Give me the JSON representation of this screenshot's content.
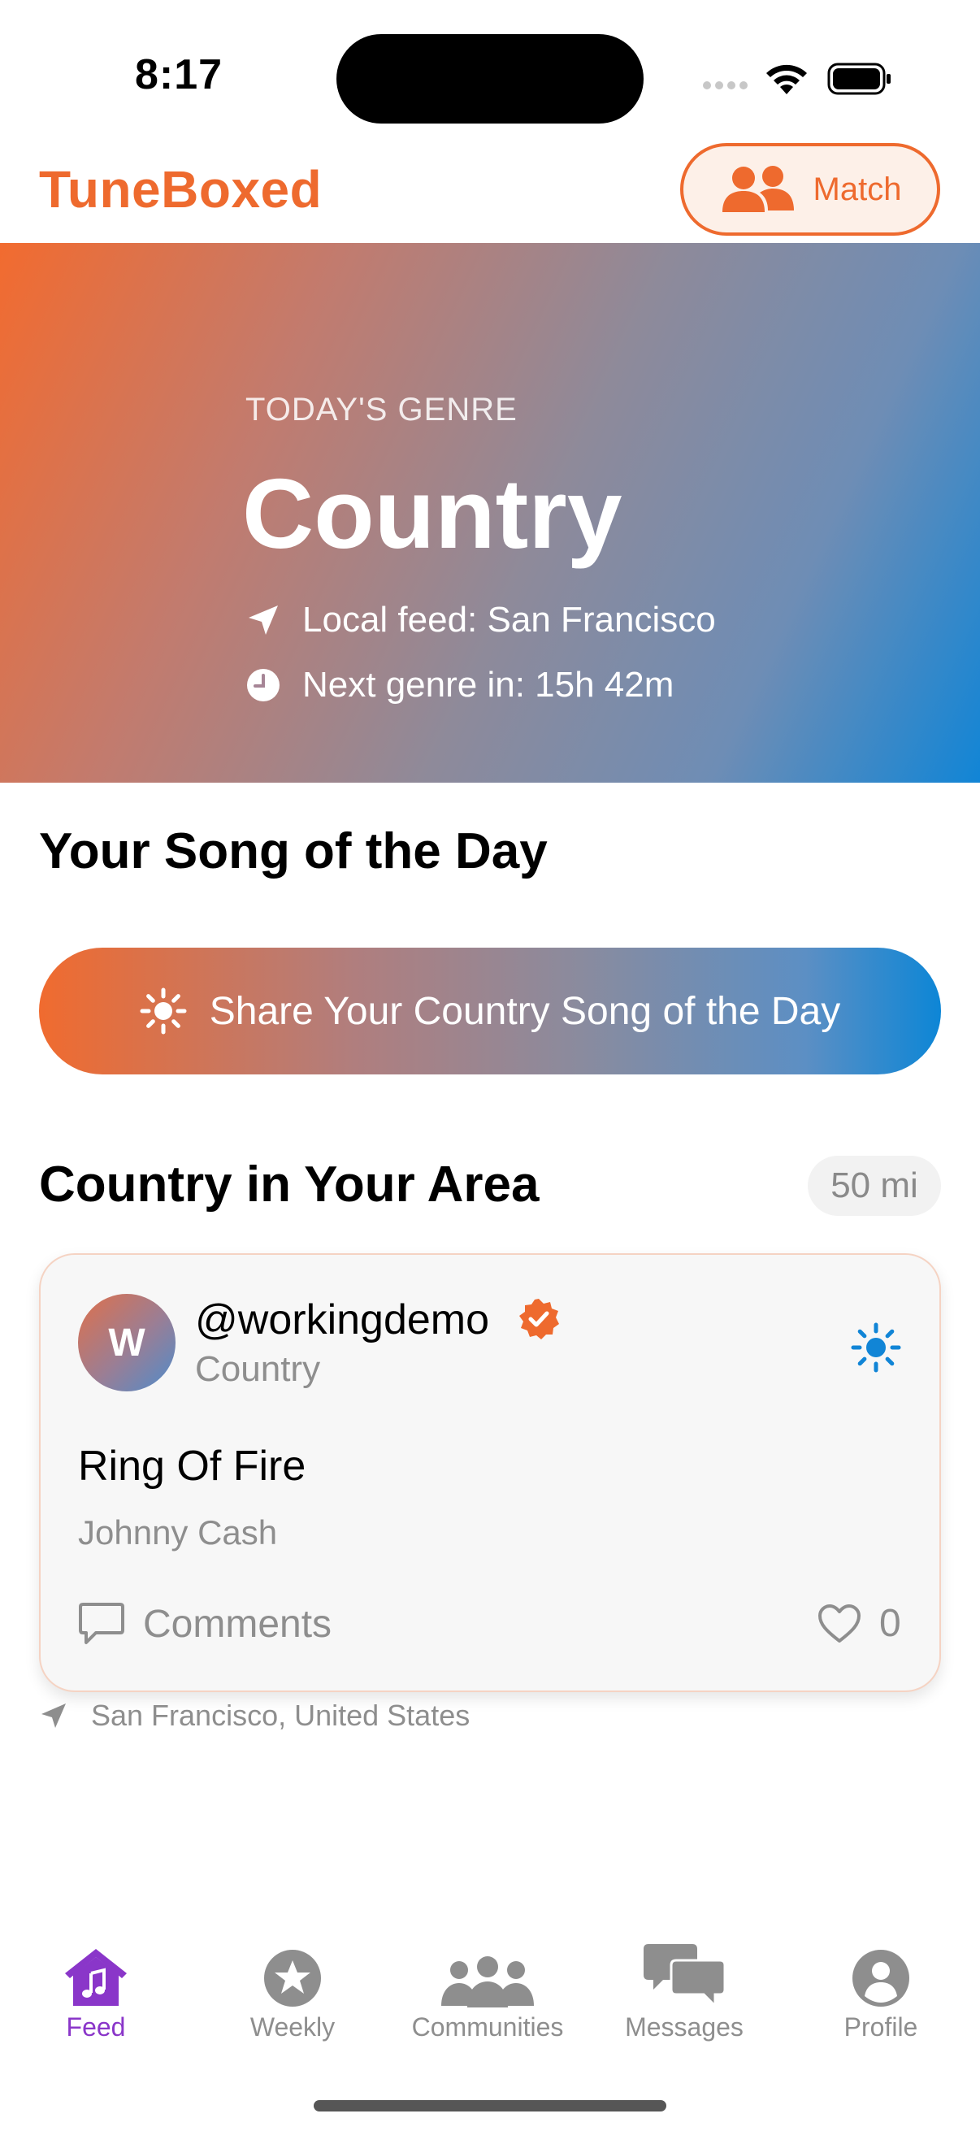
{
  "status_bar": {
    "time": "8:17"
  },
  "header": {
    "app_title": "TuneBoxed",
    "match_label": "Match"
  },
  "hero": {
    "eyebrow": "TODAY'S GENRE",
    "genre": "Country",
    "local_feed": "Local feed: San Francisco",
    "next_genre": "Next genre in: 15h 42m"
  },
  "song_of_day": {
    "title": "Your Song of the Day",
    "share_label": "Share Your Country Song of the Day"
  },
  "area": {
    "title": "Country in Your Area",
    "radius": "50 mi"
  },
  "post": {
    "avatar_initial": "W",
    "username": "@workingdemo",
    "genre": "Country",
    "song_title": "Ring Of Fire",
    "artist": "Johnny Cash",
    "comments_label": "Comments",
    "likes": "0",
    "location": "San Francisco, United States"
  },
  "tabs": [
    {
      "label": "Feed",
      "icon": "home-music-icon",
      "active": true
    },
    {
      "label": "Weekly",
      "icon": "star-circle-icon",
      "active": false
    },
    {
      "label": "Communities",
      "icon": "people-icon",
      "active": false
    },
    {
      "label": "Messages",
      "icon": "chat-bubbles-icon",
      "active": false
    },
    {
      "label": "Profile",
      "icon": "person-circle-icon",
      "active": false
    }
  ],
  "colors": {
    "brand_orange": "#EE6A2E",
    "brand_blue": "#1185D6",
    "active_tab": "#8A36C9",
    "muted": "#8E8E8E"
  }
}
